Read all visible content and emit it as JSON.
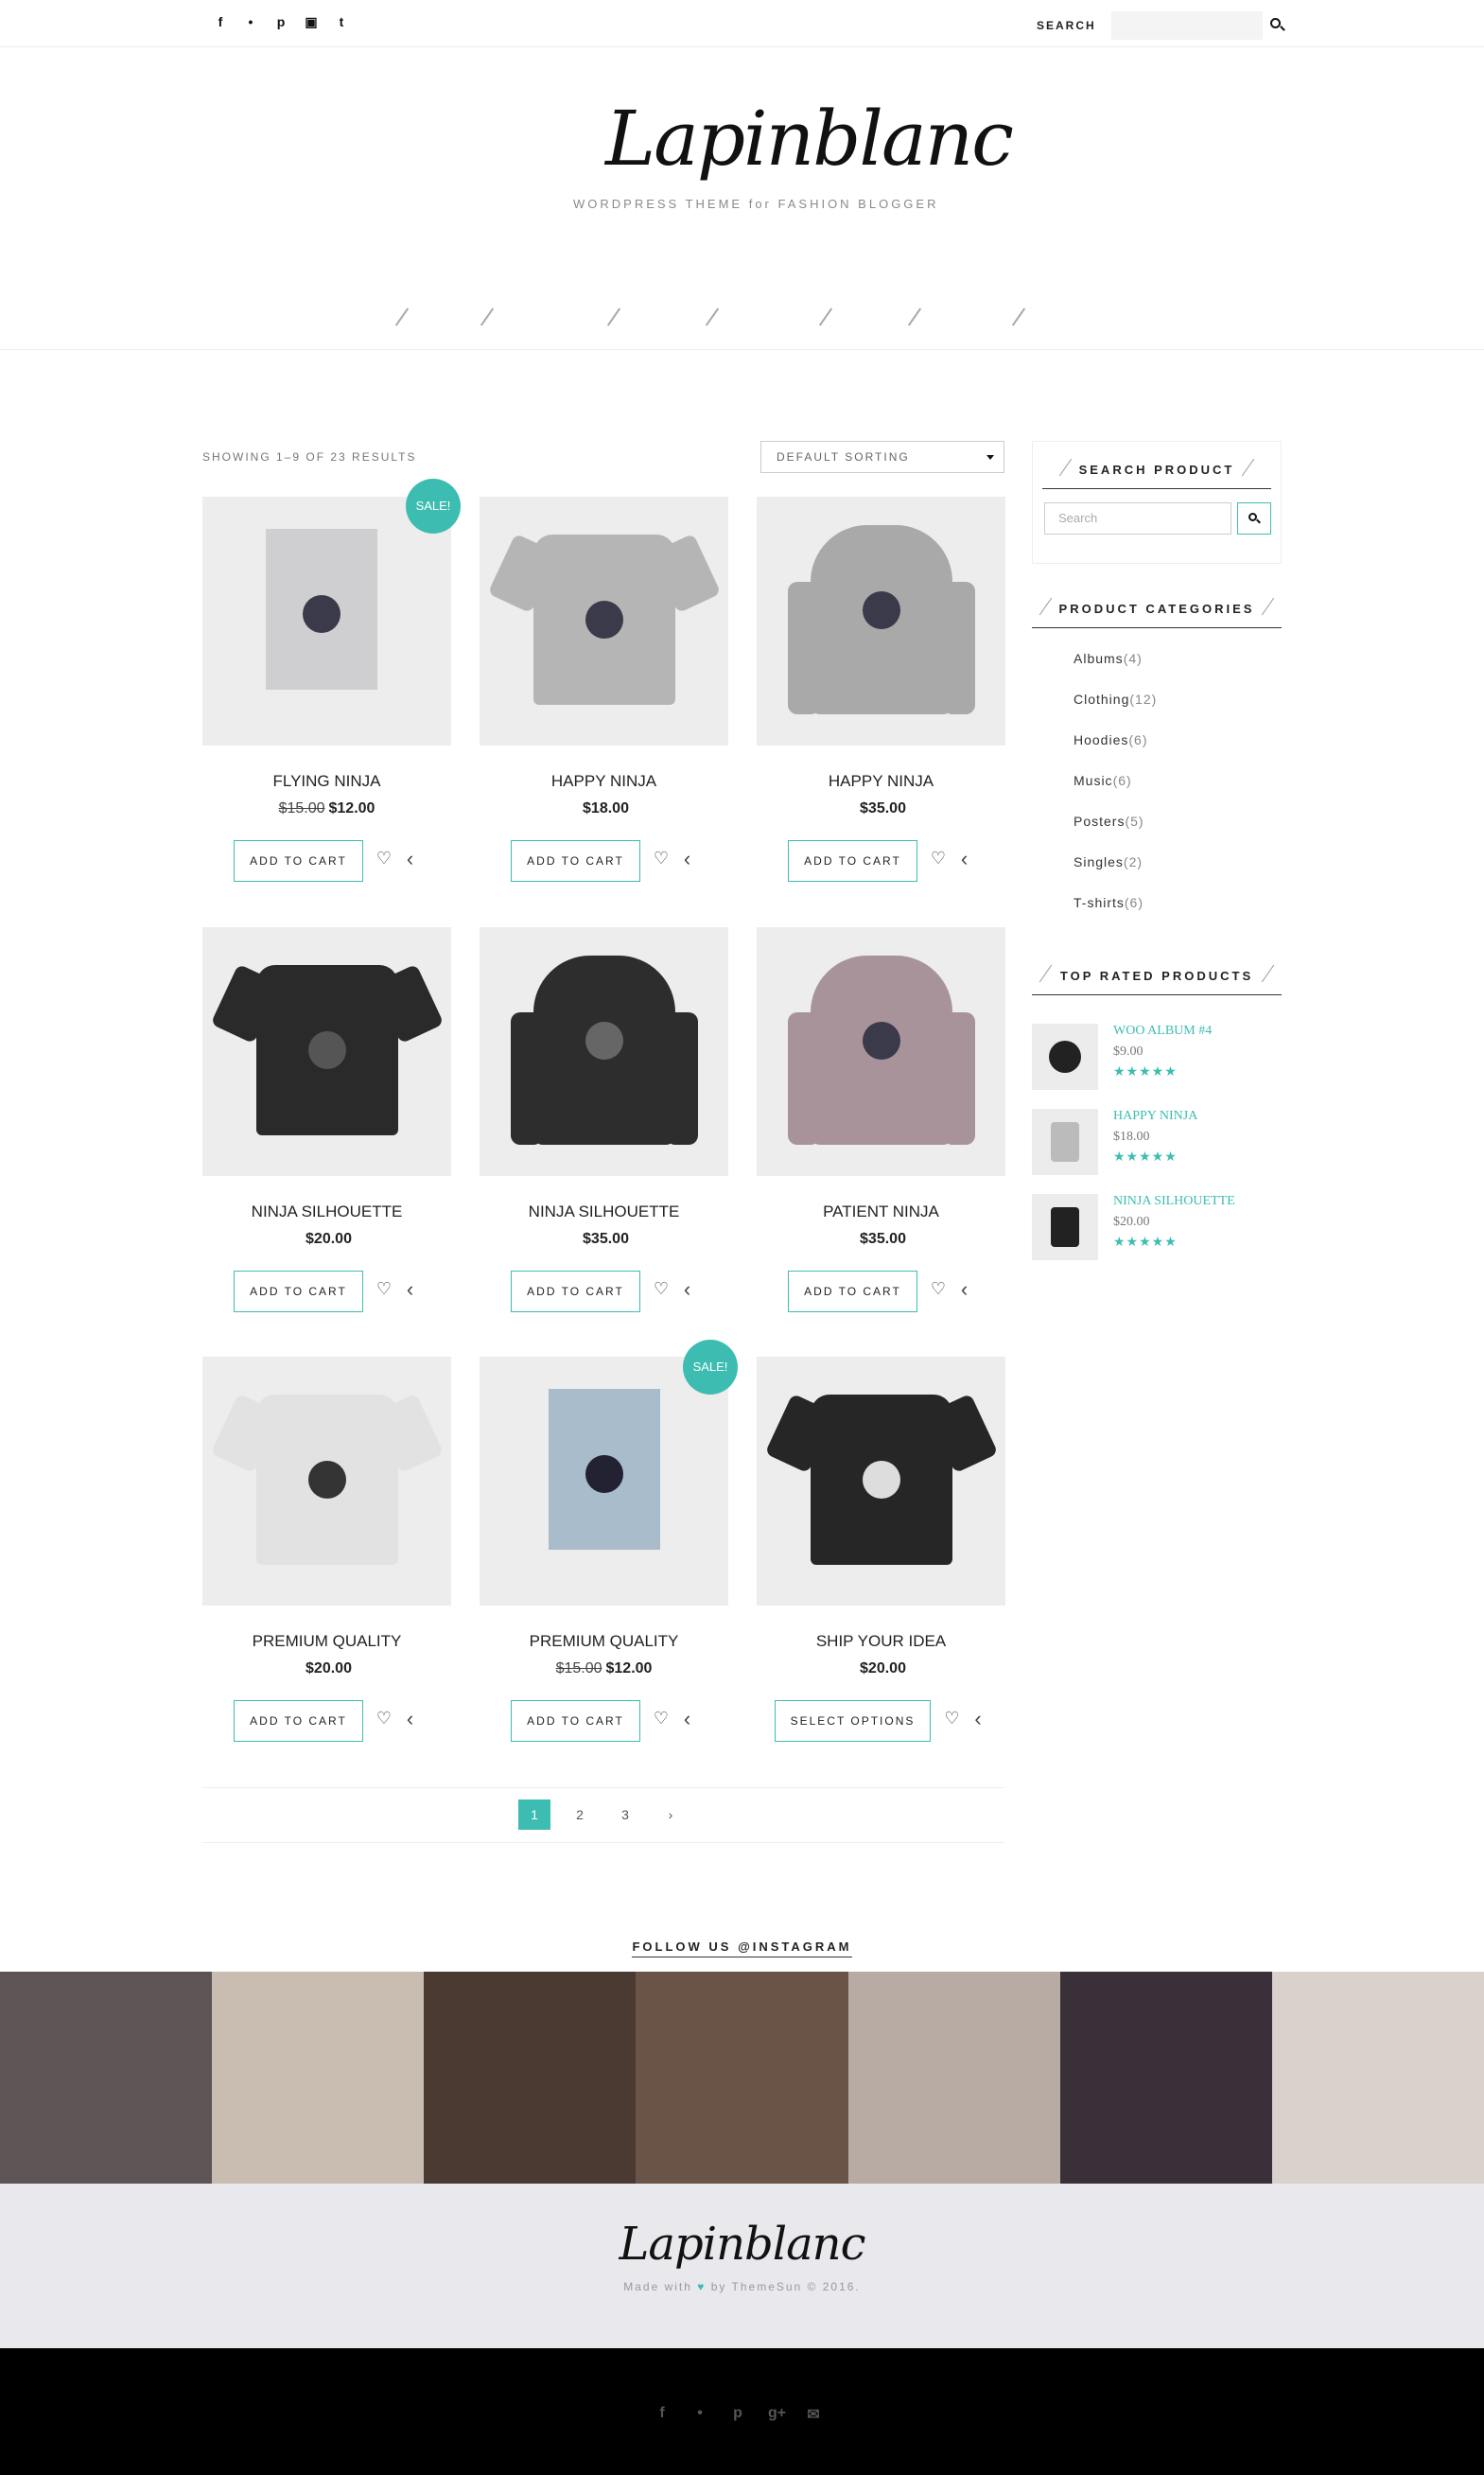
{
  "topbar": {
    "social_icons": [
      "facebook-icon",
      "twitter-icon",
      "pinterest-icon",
      "instagram-icon",
      "tumblr-icon"
    ],
    "social_glyphs": [
      "f",
      "•",
      "p",
      "▣",
      "t"
    ],
    "search_label": "SEARCH"
  },
  "logo": {
    "script": "Lapinblanc",
    "tagline": "WORDPRESS  THEME  for  FASHION BLOGGER"
  },
  "shop": {
    "results": "SHOWING 1–9 OF 23 RESULTS",
    "sorting": "DEFAULT SORTING",
    "products": [
      {
        "name": "FLYING NINJA",
        "old_price": "$15.00",
        "price": "$12.00",
        "action": "ADD TO CART",
        "sale": "SALE!"
      },
      {
        "name": "HAPPY NINJA",
        "old_price": "",
        "price": "$18.00",
        "action": "ADD TO CART",
        "sale": ""
      },
      {
        "name": "HAPPY NINJA",
        "old_price": "",
        "price": "$35.00",
        "action": "ADD TO CART",
        "sale": ""
      },
      {
        "name": "NINJA SILHOUETTE",
        "old_price": "",
        "price": "$20.00",
        "action": "ADD TO CART",
        "sale": ""
      },
      {
        "name": "NINJA SILHOUETTE",
        "old_price": "",
        "price": "$35.00",
        "action": "ADD TO CART",
        "sale": ""
      },
      {
        "name": "PATIENT NINJA",
        "old_price": "",
        "price": "$35.00",
        "action": "ADD TO CART",
        "sale": ""
      },
      {
        "name": "PREMIUM QUALITY",
        "old_price": "",
        "price": "$20.00",
        "action": "ADD TO CART",
        "sale": ""
      },
      {
        "name": "PREMIUM QUALITY",
        "old_price": "$15.00",
        "price": "$12.00",
        "action": "ADD TO CART",
        "sale": "SALE!"
      },
      {
        "name": "SHIP YOUR IDEA",
        "old_price": "",
        "price": "$20.00",
        "action": "SELECT OPTIONS",
        "sale": ""
      }
    ],
    "pagination": [
      "1",
      "2",
      "3",
      "›"
    ]
  },
  "sidebar": {
    "search_title": "SEARCH PRODUCT",
    "search_placeholder": "Search",
    "categories_title": "PRODUCT CATEGORIES",
    "categories": [
      {
        "name": "Albums",
        "count": "(4)"
      },
      {
        "name": "Clothing",
        "count": "(12)"
      },
      {
        "name": "Hoodies",
        "count": "(6)"
      },
      {
        "name": "Music",
        "count": "(6)"
      },
      {
        "name": "Posters",
        "count": "(5)"
      },
      {
        "name": "Singles",
        "count": "(2)"
      },
      {
        "name": "T-shirts",
        "count": "(6)"
      }
    ],
    "top_title": "TOP RATED PRODUCTS",
    "top_rated": [
      {
        "name": "WOO ALBUM #4",
        "price": "$9.00",
        "stars": "★★★★★"
      },
      {
        "name": "HAPPY NINJA",
        "price": "$18.00",
        "stars": "★★★★★"
      },
      {
        "name": "NINJA SILHOUETTE",
        "price": "$20.00",
        "stars": "★★★★★"
      }
    ]
  },
  "instagram": {
    "title": "FOLLOW US @INSTAGRAM"
  },
  "footer": {
    "logo": "Lapinblanc",
    "made_prefix": "Made with",
    "heart": "♥",
    "made_suffix": "by ThemeSun © 2016.",
    "social_icons": [
      "facebook-icon",
      "twitter-icon",
      "pinterest-icon",
      "google-plus-icon",
      "mail-icon"
    ],
    "social_glyphs": [
      "f",
      "•",
      "p",
      "g+",
      "✉"
    ]
  },
  "colors": {
    "accent": "#3dbdb1"
  }
}
